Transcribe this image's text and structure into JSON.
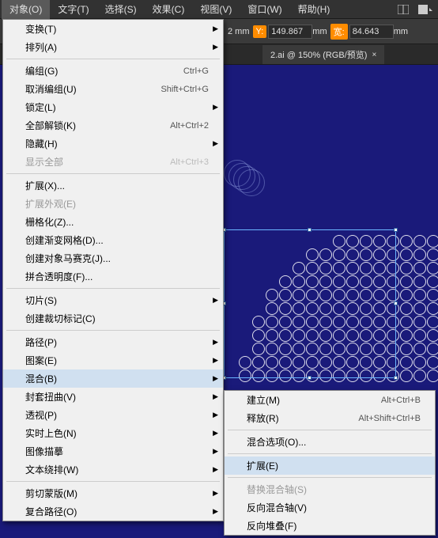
{
  "menubar": {
    "items": [
      "对象(O)",
      "文字(T)",
      "选择(S)",
      "效果(C)",
      "视图(V)",
      "窗口(W)",
      "帮助(H)"
    ]
  },
  "toolbar": {
    "x_suffix": "2 mm",
    "y_label": "Y:",
    "y_value": "149.867",
    "y_unit": " mm",
    "w_label": "宽:",
    "w_value": "84.643",
    "w_unit": " mm"
  },
  "tab": {
    "title": "2.ai @ 150% (RGB/预览)",
    "close": "×"
  },
  "menu": {
    "groups": [
      [
        {
          "label": "变换(T)",
          "arrow": true
        },
        {
          "label": "排列(A)",
          "arrow": true
        }
      ],
      [
        {
          "label": "编组(G)",
          "shortcut": "Ctrl+G"
        },
        {
          "label": "取消编组(U)",
          "shortcut": "Shift+Ctrl+G"
        },
        {
          "label": "锁定(L)",
          "arrow": true
        },
        {
          "label": "全部解锁(K)",
          "shortcut": "Alt+Ctrl+2"
        },
        {
          "label": "隐藏(H)",
          "arrow": true
        },
        {
          "label": "显示全部",
          "shortcut": "Alt+Ctrl+3",
          "disabled": true
        }
      ],
      [
        {
          "label": "扩展(X)..."
        },
        {
          "label": "扩展外观(E)",
          "disabled": true
        },
        {
          "label": "栅格化(Z)..."
        },
        {
          "label": "创建渐变网格(D)..."
        },
        {
          "label": "创建对象马赛克(J)..."
        },
        {
          "label": "拼合透明度(F)..."
        }
      ],
      [
        {
          "label": "切片(S)",
          "arrow": true
        },
        {
          "label": "创建裁切标记(C)"
        }
      ],
      [
        {
          "label": "路径(P)",
          "arrow": true
        },
        {
          "label": "图案(E)",
          "arrow": true
        },
        {
          "label": "混合(B)",
          "arrow": true,
          "highlight": true
        },
        {
          "label": "封套扭曲(V)",
          "arrow": true
        },
        {
          "label": "透视(P)",
          "arrow": true
        },
        {
          "label": "实时上色(N)",
          "arrow": true
        },
        {
          "label": "图像描摹",
          "arrow": true
        },
        {
          "label": "文本绕排(W)",
          "arrow": true
        }
      ],
      [
        {
          "label": "剪切蒙版(M)",
          "arrow": true
        },
        {
          "label": "复合路径(O)",
          "arrow": true
        }
      ]
    ]
  },
  "submenu": {
    "groups": [
      [
        {
          "label": "建立(M)",
          "shortcut": "Alt+Ctrl+B"
        },
        {
          "label": "释放(R)",
          "shortcut": "Alt+Shift+Ctrl+B"
        }
      ],
      [
        {
          "label": "混合选项(O)..."
        }
      ],
      [
        {
          "label": "扩展(E)",
          "highlight": true
        }
      ],
      [
        {
          "label": "替换混合轴(S)",
          "disabled": true
        },
        {
          "label": "反向混合轴(V)"
        },
        {
          "label": "反向堆叠(F)"
        }
      ]
    ]
  }
}
